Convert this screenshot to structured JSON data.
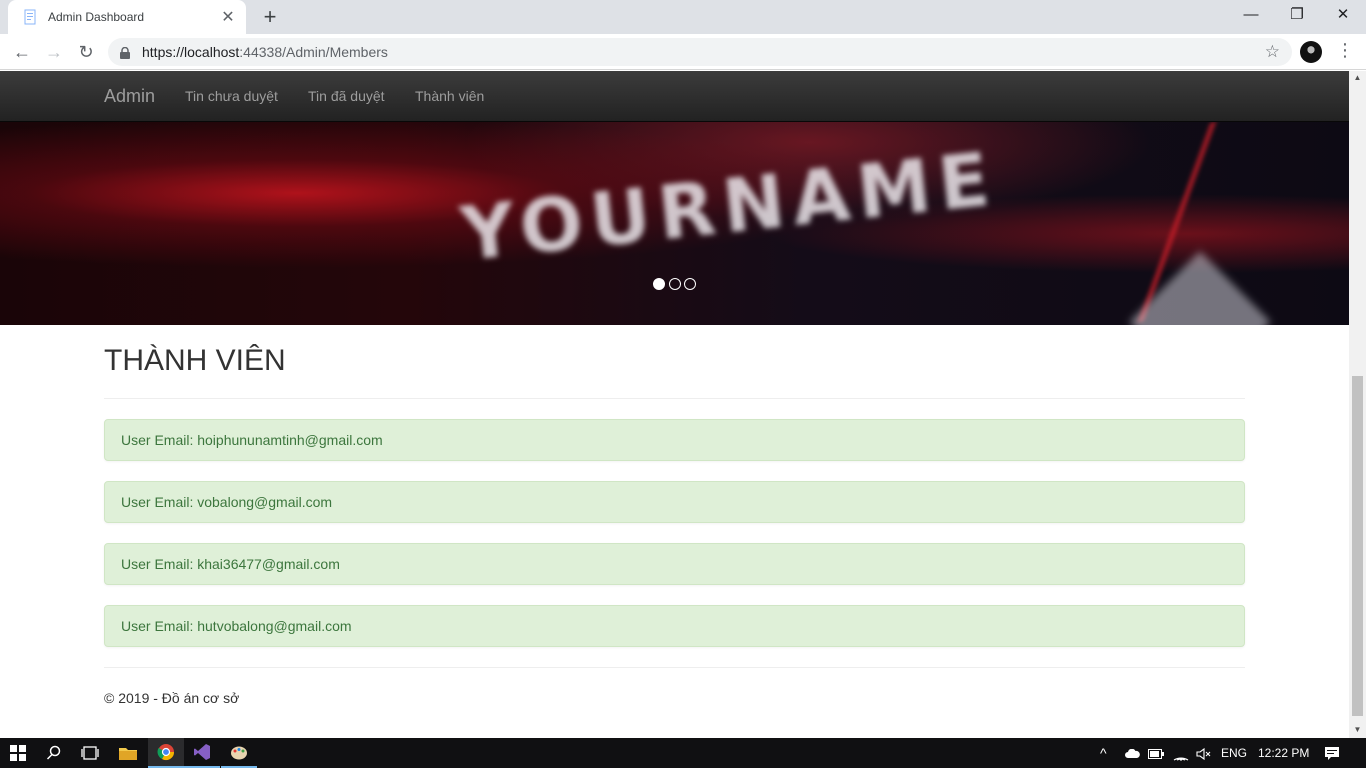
{
  "browser": {
    "tab_title": "Admin Dashboard",
    "tab_close": "✕",
    "new_tab": "+",
    "url_host": "https://localhost",
    "url_rest": ":44338/Admin/Members",
    "window_min": "—",
    "window_restore": "❐",
    "window_close": "✕",
    "back": "←",
    "forward": "→",
    "reload": "↻",
    "bookmark": "☆",
    "menu": "⋮"
  },
  "navbar": {
    "brand": "Admin",
    "links": [
      "Tin chưa duyệt",
      "Tin đã duyệt",
      "Thành viên"
    ]
  },
  "carousel": {
    "banner_text": "YOURNAME",
    "slide_count": 3,
    "active_index": 0
  },
  "main": {
    "title": "THÀNH VIÊN",
    "members": [
      "User Email: hoiphununamtinh@gmail.com",
      "User Email: vobalong@gmail.com",
      "User Email: khai36477@gmail.com",
      "User Email: hutvobalong@gmail.com"
    ]
  },
  "footer": {
    "text": "© 2019 - Đồ án cơ sở"
  },
  "taskbar": {
    "language": "ENG",
    "time": "12:22 PM"
  },
  "colors": {
    "navbar_bg": "#222222",
    "alert_bg": "#dff0d8",
    "alert_text": "#3c763d",
    "accent": "#76b9ed"
  }
}
